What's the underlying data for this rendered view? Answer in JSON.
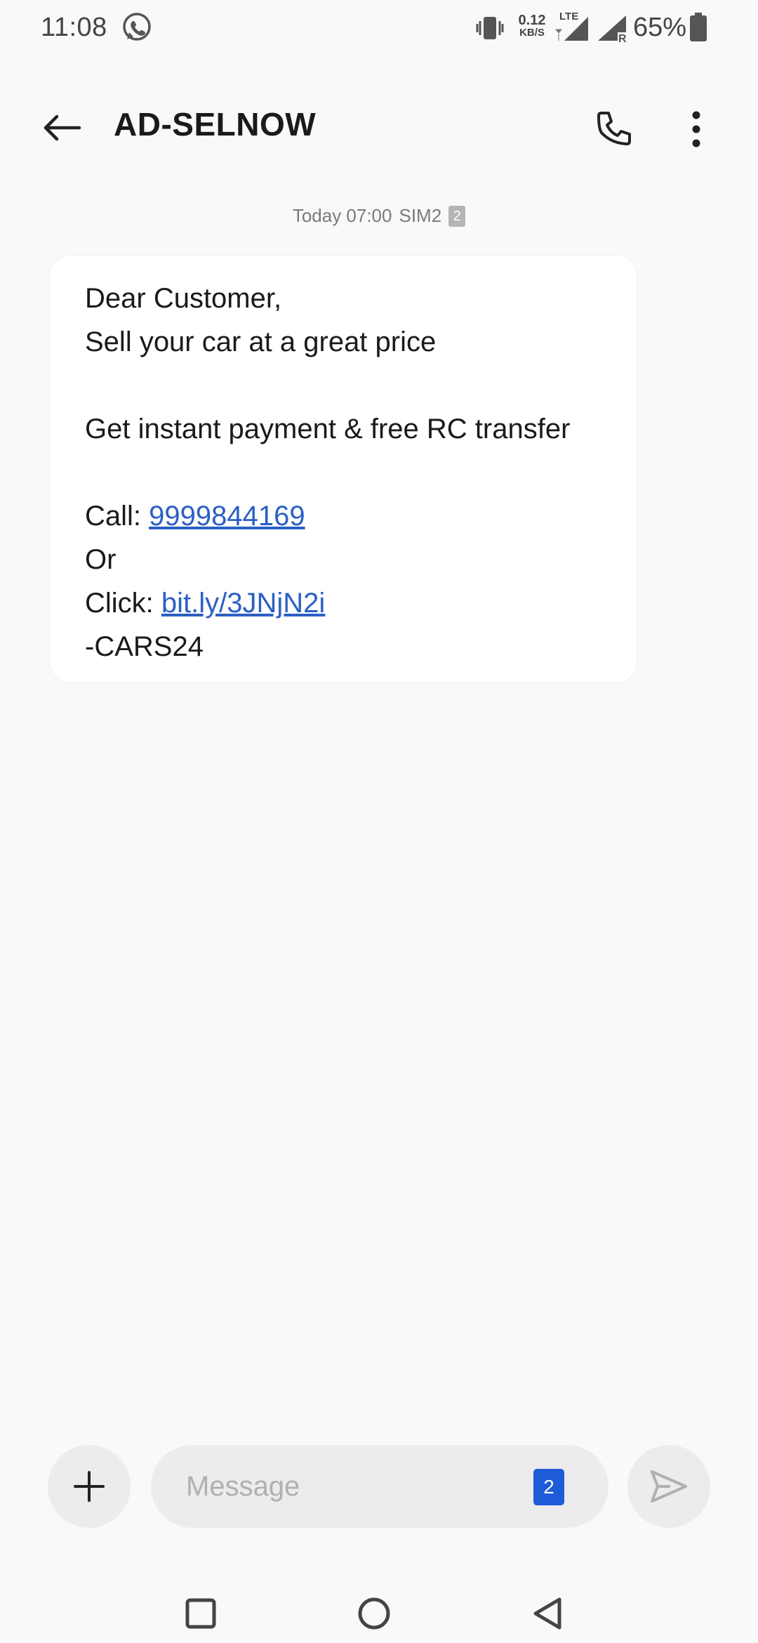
{
  "status_bar": {
    "time": "11:08",
    "net_speed_value": "0.12",
    "net_speed_unit": "KB/S",
    "network_type": "LTE",
    "roaming_label": "R",
    "battery_percent": "65%",
    "icons": [
      "whatsapp-icon",
      "vibrate-icon",
      "signal-icon",
      "signal-roaming-icon",
      "battery-icon"
    ]
  },
  "app_bar": {
    "title": "AD-SELNOW",
    "icons": [
      "back-arrow-icon",
      "phone-icon",
      "more-vert-icon"
    ]
  },
  "conversation": {
    "timestamp": "Today 07:00",
    "sim_label": "SIM2",
    "sim_badge": "2",
    "message": {
      "line1": "Dear Customer,",
      "line2": "Sell your car at a great price",
      "line3": "Get instant payment & free RC transfer",
      "call_prefix": "Call: ",
      "phone_link": "9999844169",
      "or_text": "Or",
      "click_prefix": "Click: ",
      "url_link": "bit.ly/3JNjN2i",
      "signature": "-CARS24"
    }
  },
  "composer": {
    "placeholder": "Message",
    "sim_selector": "2",
    "icons": [
      "add-icon",
      "send-icon"
    ]
  },
  "nav_bar": {
    "icons": [
      "recents-square-icon",
      "home-circle-icon",
      "back-triangle-icon"
    ]
  },
  "colors": {
    "background": "#f9f9f9",
    "bubble": "#ffffff",
    "link": "#2b5fc4",
    "sim_accent": "#1e5bd8"
  }
}
